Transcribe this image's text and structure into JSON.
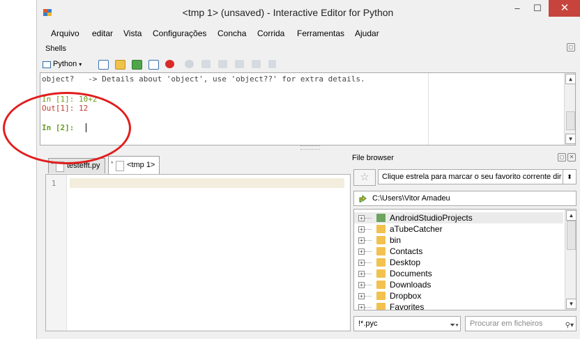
{
  "window": {
    "title": "<tmp 1> (unsaved) - Interactive Editor for Python",
    "min_glyph": "–",
    "max_glyph": "☐",
    "close_glyph": "✕"
  },
  "menu": [
    "Arquivo",
    "editar",
    "Vista",
    "Configurações",
    "Concha",
    "Corrida",
    "Ferramentas",
    "Ajudar"
  ],
  "shells": {
    "label": "Shells",
    "python_button": "Python",
    "lines": [
      "object?   -> Details about 'object', use 'object??' for extra details.",
      "",
      "In [1]: 10+2",
      "Out[1]: 12",
      "",
      "In [2]: "
    ]
  },
  "editor": {
    "tabs": [
      {
        "label": "testefft.py",
        "active": false
      },
      {
        "label": "<tmp 1>",
        "active": true
      }
    ],
    "line_numbers": [
      "1"
    ]
  },
  "file_browser": {
    "title": "File browser",
    "favorites_placeholder": "Clique estrela para marcar o seu favorito corrente dir",
    "path": "C:\\Users\\Vitor Amadeu",
    "items": [
      {
        "name": "AndroidStudioProjects",
        "selected": true
      },
      {
        "name": "aTubeCatcher",
        "selected": false
      },
      {
        "name": "bin",
        "selected": false
      },
      {
        "name": "Contacts",
        "selected": false
      },
      {
        "name": "Desktop",
        "selected": false
      },
      {
        "name": "Documents",
        "selected": false
      },
      {
        "name": "Downloads",
        "selected": false
      },
      {
        "name": "Dropbox",
        "selected": false
      },
      {
        "name": "Favorites",
        "selected": false
      }
    ],
    "filter": "!*.pyc",
    "search_placeholder": "Procurar em ficheiros"
  },
  "colors": {
    "in_prompt": "#6a9a1f",
    "out_prompt": "#c0392b",
    "annotation": "#e21d1d",
    "close_button": "#c7443c"
  }
}
